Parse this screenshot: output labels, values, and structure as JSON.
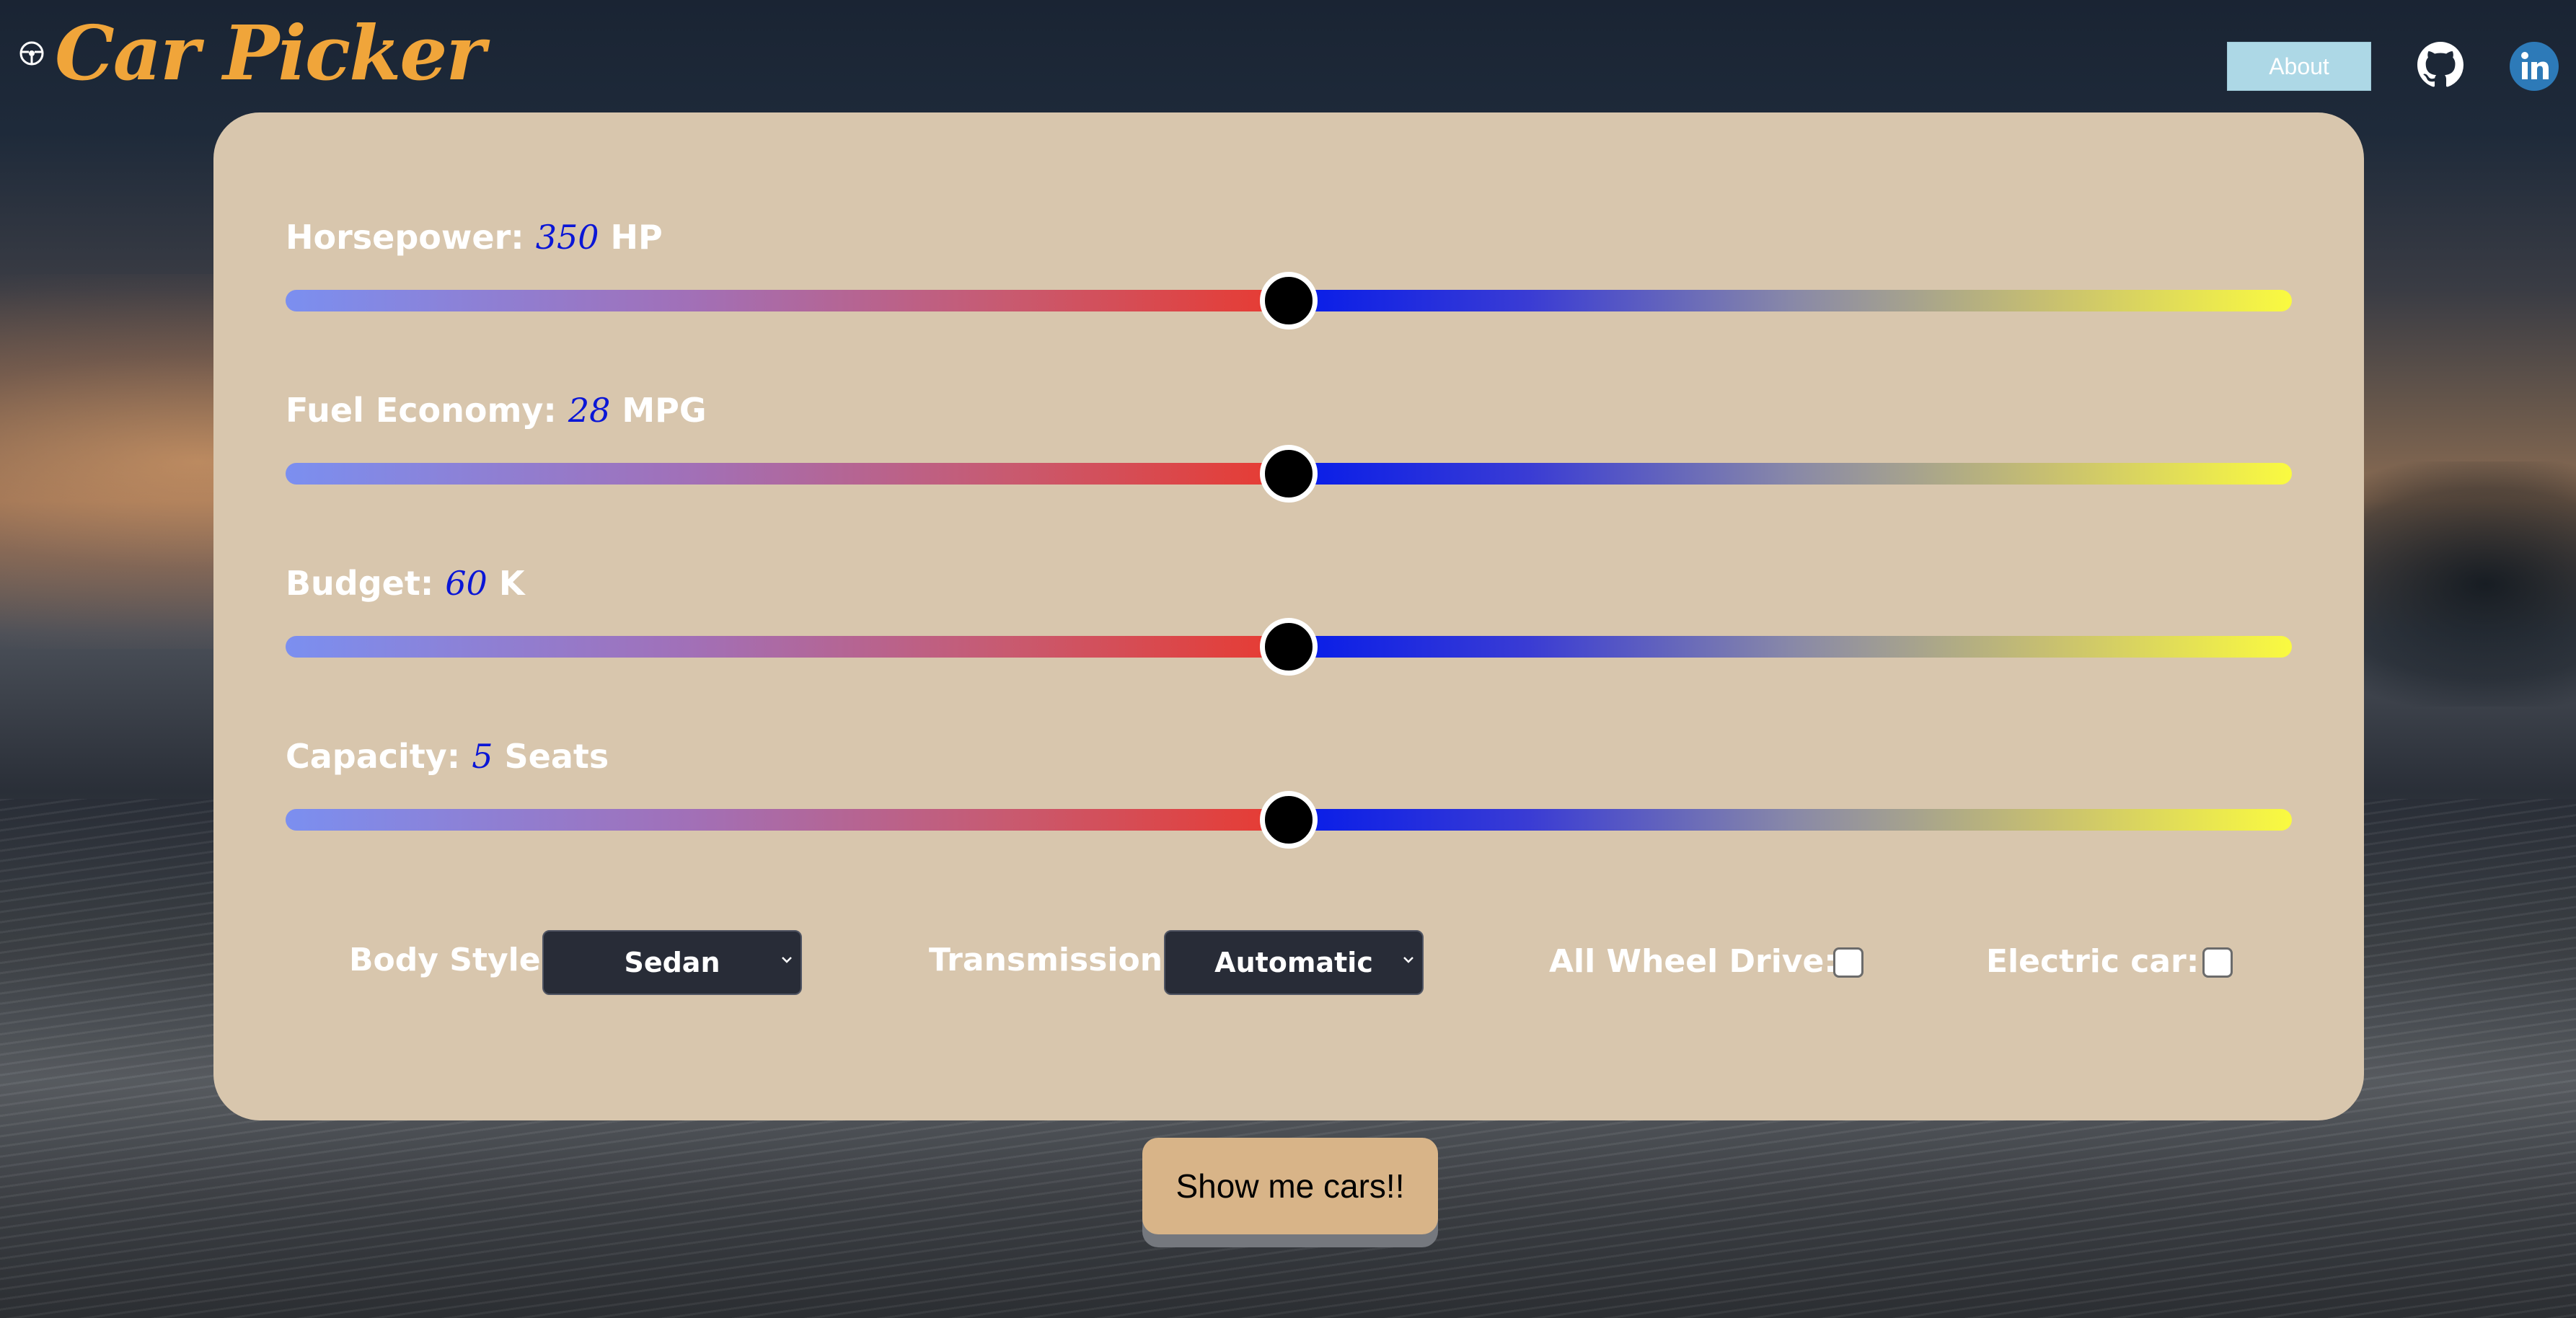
{
  "app": {
    "title": "Car Picker",
    "logo_icon": "steering-wheel-icon"
  },
  "header": {
    "about_label": "About",
    "github_icon": "github-icon",
    "linkedin_icon": "linkedin-icon"
  },
  "sliders": [
    {
      "label": "Horsepower:",
      "value": "350",
      "unit": "HP",
      "fraction": 0.5
    },
    {
      "label": "Fuel Economy:",
      "value": "28",
      "unit": "MPG",
      "fraction": 0.5
    },
    {
      "label": "Budget:",
      "value": "60",
      "unit": "K",
      "fraction": 0.5
    },
    {
      "label": "Capacity:",
      "value": "5",
      "unit": "Seats",
      "fraction": 0.5
    }
  ],
  "filters": {
    "body_style_label": "Body Style:",
    "body_style_value": "Sedan",
    "transmission_label": "Transmission:",
    "transmission_value": "Automatic",
    "awd_label": "All Wheel Drive:",
    "awd_checked": false,
    "electric_label": "Electric car:",
    "electric_checked": false
  },
  "submit_label": "Show me cars!!",
  "colors": {
    "logo": "#f0a53a",
    "panel": "#d8c6ad",
    "value_text": "#0a16d6",
    "about_button": "#add8e6",
    "submit_button": "#d8b488"
  }
}
